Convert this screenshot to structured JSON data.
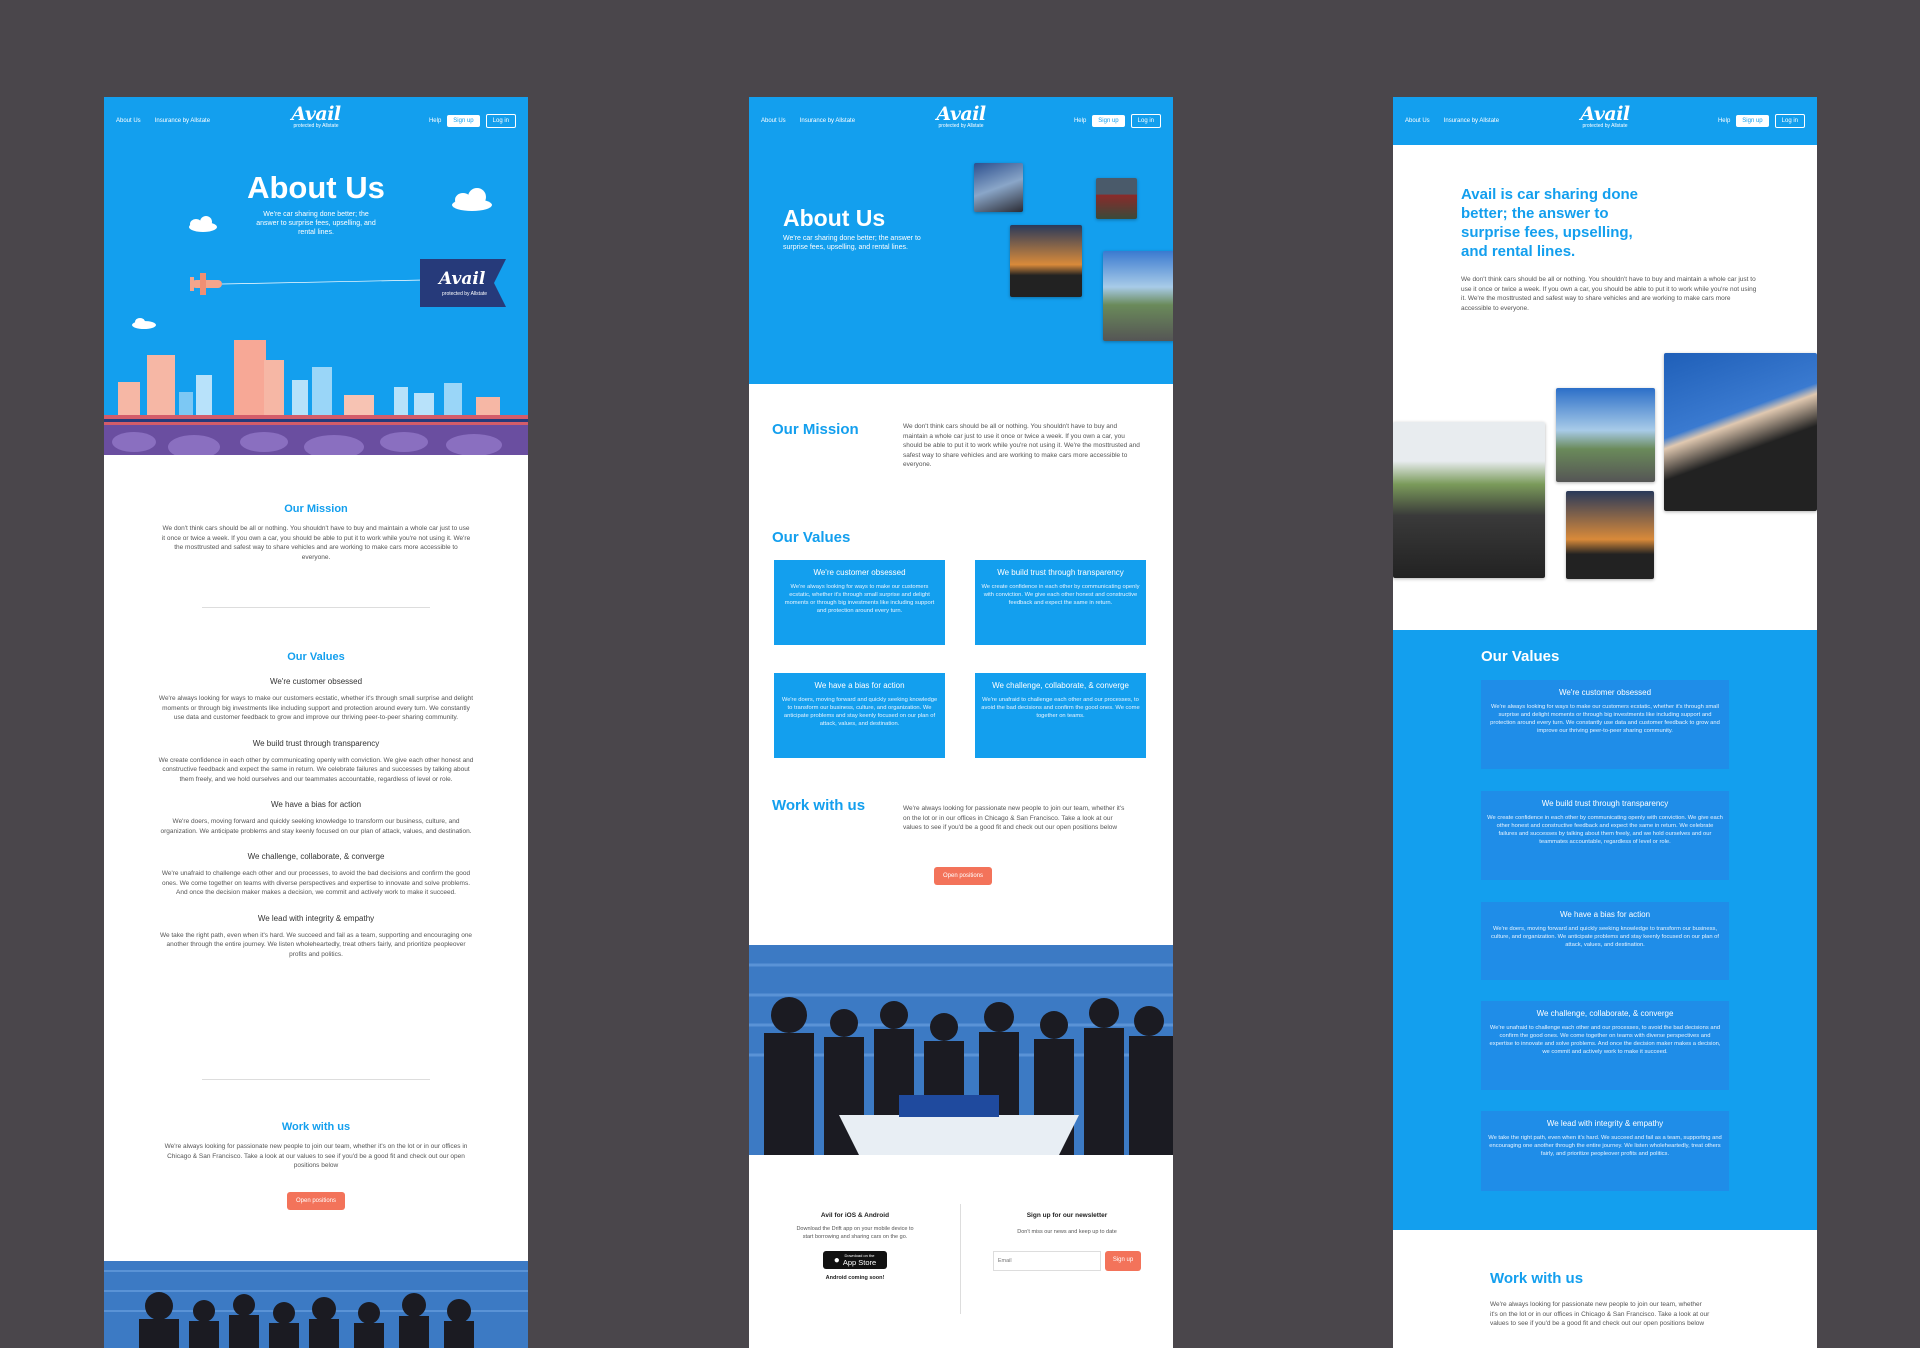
{
  "nav": {
    "about_us": "About Us",
    "insurance": "Insurance by Allstate",
    "logo_word": "Avail",
    "logo_sub": "protected by Allstate",
    "help": "Help",
    "sign_up": "Sign up",
    "log_in": "Log in"
  },
  "colors": {
    "brand_blue": "#139fee",
    "deep_blue": "#1f8de8",
    "coral": "#f3735a",
    "background": "#4a464b"
  },
  "board1": {
    "hero_title": "About Us",
    "hero_sub": "We're car sharing done better; the answer to surprise fees, upselling, and rental lines.",
    "banner_word": "Avail",
    "banner_sub": "protected by Allstate",
    "mission_title": "Our Mission",
    "mission_text": "We don't think cars should be all or nothing. You shouldn't have to buy and maintain a whole car just to use it once or twice a week. If you own a car, you should be able to put it to work while you're not using it.  We're the mosttrusted and safest way to share vehicles and are working to make cars more accessible to everyone.",
    "values_title": "Our Values",
    "values": [
      {
        "title": "We're customer obsessed",
        "text": "We're always looking for ways to make our customers ecstatic, whether it's through small surprise and delight moments or through big investments like including support and protection around every turn. We constantly use data and customer feedback to grow and improve our thriving peer-to-peer sharing community."
      },
      {
        "title": "We build trust through transparency",
        "text": "We create confidence in each other by communicating openly with conviction. We give each other honest and constructive feedback and expect the same in return. We celebrate failures and successes by talking about them freely, and we hold ourselves and our teammates accountable, regardless of level or role."
      },
      {
        "title": "We have a bias for action",
        "text": "We're doers, moving forward and quickly seeking knowledge to transform our business, culture, and organization. We anticipate problems and stay keenly focused on our plan of attack, values, and destination."
      },
      {
        "title": "We challenge, collaborate, & converge",
        "text": "We're unafraid to challenge each other and our processes, to avoid the bad decisions and confirm the good ones. We come together on teams with diverse perspectives and expertise to innovate and solve problems. And once the decision maker makes a decision, we commit and actively work to make it succeed."
      },
      {
        "title": "We lead with integrity & empathy",
        "text": "We take the right path, even when it's hard. We succeed and fail as a team, supporting and encouraging one another through the entire journey. We listen wholeheartedly, treat others fairly, and prioritize peopleover profits and politics."
      }
    ],
    "work_title": "Work with us",
    "work_text": "We're always looking for passionate new people to join our team, whether it's on the lot or in our offices in Chicago & San Francisco. Take a look at our values to see if you'd be a good fit and check out our open positions below",
    "open_positions": "Open positions"
  },
  "board2": {
    "hero_title": "About Us",
    "hero_sub": "We're car sharing done better; the answer to surprise fees, upselling, and rental lines.",
    "mission_title": "Our Mission",
    "mission_text": "We don't think cars should be all or nothing. You shouldn't have to buy and maintain a whole car just to use it once or twice a week. If you own a car, you should be able to put it to work while you're not using it.  We're the mosttrusted and safest way to share vehicles and are working to make cars more accessible to everyone.",
    "values_title": "Our Values",
    "values": [
      {
        "title": "We're customer obsessed",
        "text": "We're always looking for ways to make our customers ecstatic, whether it's through small surprise and delight moments or through big investments like including support and protection around every turn."
      },
      {
        "title": "We build trust through transparency",
        "text": "We create confidence in each other by communicating openly with conviction. We give each other honest and constructive feedback and expect the same in return."
      },
      {
        "title": "We have a bias for action",
        "text": "We're doers, moving forward and quickly seeking knowledge to transform our business, culture, and organization. We anticipate problems and stay keenly focused on our plan of attack, values, and destination."
      },
      {
        "title": "We challenge, collaborate, & converge",
        "text": "We're unafraid to challenge each other and our processes, to avoid the bad decisions and confirm the good ones. We come together on teams."
      }
    ],
    "work_title": "Work with us",
    "work_text": "We're always looking for passionate new people to join our team, whether it's on the lot or in our offices in Chicago & San Francisco. Take a look at our values to see if you'd be a good fit and check out our open positions below",
    "open_positions": "Open positions",
    "app_title": "Avil for iOS & Android",
    "app_text": "Download the Drift app on your mobile device to start borrowing and sharing cars on the go.",
    "app_store_small": "Download on the",
    "app_store": "App Store",
    "android": "Android coming soon!",
    "newsletter_title": "Sign up for our newsletter",
    "newsletter_text": "Don't miss our news and keep up to date",
    "email_placeholder": "Email",
    "newsletter_button": "Sign up"
  },
  "board3": {
    "hero_title": "Avail is car sharing done better; the answer to surprise fees, upselling, and rental lines.",
    "hero_text": "We don't think cars should be all or nothing. You shouldn't have to buy and maintain a whole car just to use it once or twice a week. If you own a car, you should be able to put it to work while you're not using it.  We're the mosttrusted and safest way to share vehicles and are working to make cars more accessible to everyone.",
    "values_title": "Our Values",
    "values": [
      {
        "title": "We're customer obsessed",
        "text": "We're always looking for ways to make our customers ecstatic, whether it's through small surprise and delight moments or through big investments like including support and protection around every turn. We constantly use data and customer feedback to grow and improve our thriving peer-to-peer sharing community."
      },
      {
        "title": "We build trust through transparency",
        "text": "We create confidence in each other by communicating openly with conviction. We give each other honest and constructive feedback and expect the same in return. We celebrate failures and successes by talking about them freely, and we hold ourselves and our teammates accountable, regardless of level or role."
      },
      {
        "title": "We have a bias for action",
        "text": "We're doers, moving forward and quickly seeking knowledge to transform our business, culture, and organization. We anticipate problems and stay keenly focused on our plan of attack, values, and destination."
      },
      {
        "title": "We challenge, collaborate, & converge",
        "text": "We're unafraid to challenge each other and our processes, to avoid the bad decisions and confirm the good ones. We come together on teams with diverse perspectives and expertise to innovate and solve problems. And once the decision maker makes a decision, we commit and actively work to make it succeed."
      },
      {
        "title": "We lead with integrity & empathy",
        "text": "We take the right path, even when it's hard. We succeed and fail as a team, supporting and encouraging one another through the entire journey. We listen wholeheartedly, treat others fairly, and prioritize peopleover profits and politics."
      }
    ],
    "work_title": "Work with us",
    "work_text": "We're always looking for passionate new people to join our team, whether it's on the lot or in our offices in Chicago & San Francisco. Take a look at our values to see if you'd be a good fit and check out our open positions below"
  }
}
